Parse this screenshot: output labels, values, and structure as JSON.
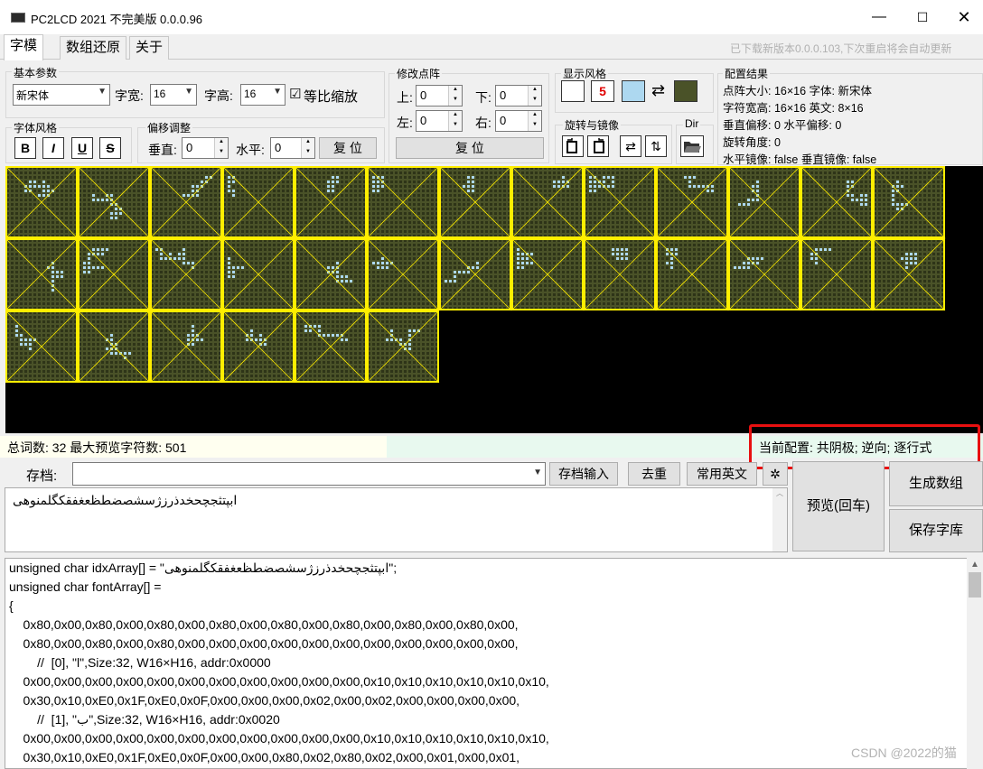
{
  "window": {
    "title": "PC2LCD 2021 不完美版 0.0.0.96",
    "minimize": "—",
    "maximize": "☐",
    "close": "✕"
  },
  "tabs": [
    {
      "label": "字模"
    },
    {
      "label": "数组还原"
    },
    {
      "label": "关于"
    }
  ],
  "update_notice": "已下载新版本0.0.0.103,下次重启将会自动更新",
  "basic": {
    "title": "基本参数",
    "font": "新宋体",
    "width_label": "字宽:",
    "width": "16",
    "height_label": "字高:",
    "height": "16",
    "proportional_label": "等比缩放",
    "proportional_checked": "☑"
  },
  "style": {
    "title": "字体风格",
    "bold": "B",
    "italic": "I",
    "underline": "U",
    "strike": "S"
  },
  "offset": {
    "title": "偏移调整",
    "vertical_label": "垂直:",
    "vertical": "0",
    "horizontal_label": "水平:",
    "horizontal": "0",
    "reset": "复 位"
  },
  "modify": {
    "title": "修改点阵",
    "up_label": "上:",
    "up": "0",
    "down_label": "下:",
    "down": "0",
    "left_label": "左:",
    "left": "0",
    "right_label": "右:",
    "right": "0",
    "reset": "复 位"
  },
  "display": {
    "title": "显示风格",
    "sample": "5",
    "swap": "⇄",
    "colors": {
      "bg": "#ffffff",
      "fg": "#add8f0",
      "dark": "#4a5228"
    }
  },
  "rotate": {
    "title": "旋转与镜像",
    "dir_title": "Dir"
  },
  "config": {
    "title": "配置结果",
    "line1": "点阵大小: 16×16  字体: 新宋体",
    "line2": "字符宽高: 16×16  英文: 8×16",
    "line3": "垂直偏移: 0  水平偏移: 0",
    "line4": "旋转角度: 0",
    "line5": "水平镜像: false  垂直镜像: false"
  },
  "status": {
    "left": "总词数: 32 最大预览字符数: 501",
    "current": "当前配置: 共阴极; 逆向; 逐行式"
  },
  "archive": {
    "label": "存档:",
    "input_btn": "存档输入",
    "dedupe_btn": "去重",
    "common_btn": "常用英文",
    "settings_icon": "✲"
  },
  "input_text": "ابپتثجچحخدذرزژسشصضطظعغفقکگلمنوهی",
  "actions": {
    "preview": "预览(回车)",
    "generate": "生成数组",
    "save": "保存字库"
  },
  "code_lines": [
    "unsigned char idxArray[] = \"ابپتثجچحخدذرزژسشصضطظعغفقکگلمنوهی\";",
    "unsigned char fontArray[] =",
    "{",
    "    0x80,0x00,0x80,0x00,0x80,0x00,0x80,0x00,0x80,0x00,0x80,0x00,0x80,0x00,0x80,0x00,",
    "    0x80,0x00,0x80,0x00,0x80,0x00,0x00,0x00,0x00,0x00,0x00,0x00,0x00,0x00,0x00,0x00,",
    "        //  [0], \"l\",Size:32, W16×H16, addr:0x0000",
    "    0x00,0x00,0x00,0x00,0x00,0x00,0x00,0x00,0x00,0x00,0x00,0x10,0x10,0x10,0x10,0x10,0x10,",
    "    0x30,0x10,0xE0,0x1F,0xE0,0x0F,0x00,0x00,0x00,0x02,0x00,0x02,0x00,0x00,0x00,0x00,",
    "        //  [1], \"ب\",Size:32, W16×H16, addr:0x0020",
    "    0x00,0x00,0x00,0x00,0x00,0x00,0x00,0x00,0x00,0x00,0x00,0x10,0x10,0x10,0x10,0x10,0x10,",
    "    0x30,0x10,0xE0,0x1F,0xE0,0x0F,0x00,0x00,0x80,0x02,0x80,0x02,0x00,0x01,0x00,0x01,"
  ],
  "watermark": "CSDN @2022的猫",
  "preview_grid": {
    "count": 32,
    "per_row": 13
  }
}
